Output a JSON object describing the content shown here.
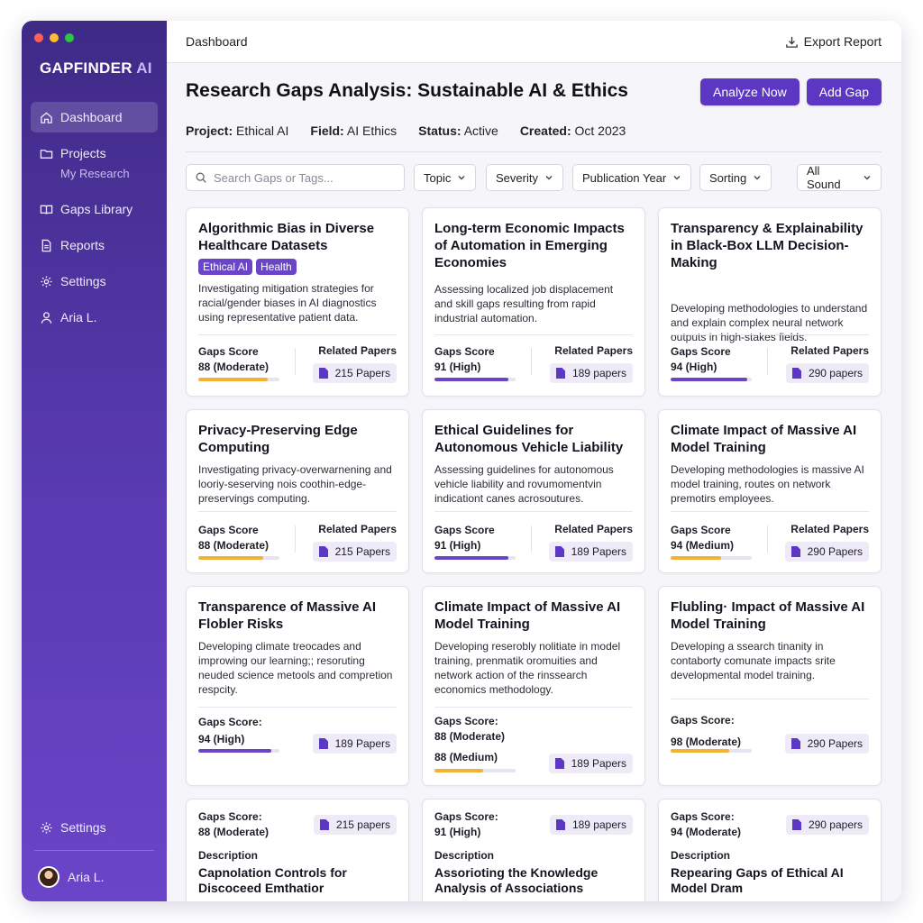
{
  "sidebar": {
    "brand_main": "GAPFINDER",
    "brand_ai": "AI",
    "items": [
      {
        "label": "Dashboard",
        "icon": "home-icon"
      },
      {
        "label": "Projects",
        "icon": "folder-icon",
        "sub": "My Research"
      },
      {
        "label": "Gaps Library",
        "icon": "book-icon"
      },
      {
        "label": "Reports",
        "icon": "document-icon"
      },
      {
        "label": "Settings",
        "icon": "gear-icon"
      },
      {
        "label": "Aria L.",
        "icon": "user-icon"
      }
    ],
    "bottom_settings": "Settings",
    "bottom_user": "Aria L."
  },
  "topbar": {
    "breadcrumb": "Dashboard",
    "export_label": "Export Report"
  },
  "header": {
    "title": "Research Gaps Analysis: Sustainable AI & Ethics",
    "analyze_label": "Analyze Now",
    "add_label": "Add Gap"
  },
  "meta": {
    "project_label": "Project:",
    "project": "Ethical AI",
    "field_label": "Field:",
    "field": "AI Ethics",
    "status_label": "Status:",
    "status": "Active",
    "created_label": "Created:",
    "created": "Oct 2023"
  },
  "filters": {
    "search_placeholder": "Search Gaps or Tags...",
    "topic": "Topic",
    "severity": "Severity",
    "year": "Publication Year",
    "sorting": "Sorting",
    "sound": "All Sound"
  },
  "colors": {
    "accent": "#5b37c4",
    "bar_high": "#6a45c8",
    "bar_moderate": "#f2b233"
  },
  "cards": [
    {
      "title": "Algorithmic Bias in Diverse Healthcare Datasets",
      "tags": [
        "Ethical AI",
        "Health"
      ],
      "desc": "Investigating mitigation strategies for racial/gender biases in AI diagnostics using representative patient data.",
      "score_label": "Gaps Score",
      "score": "88 (Moderate)",
      "related_label": "Related Papers",
      "papers": "215 Papers",
      "progress": 0.85
    },
    {
      "title": "Long-term Economic Impacts of Automation in Emerging Economies",
      "desc": "Assessing localized job displacement and skill gaps resulting from rapid industrial automation.",
      "score_label": "Gaps Score",
      "score": "91 (High)",
      "related_label": "Related Papers",
      "papers": "189 papers",
      "progress": 0.91
    },
    {
      "title": "Transparency & Explainability in Black-Box LLM Decision-Making",
      "desc": "Developing methodologies to understand and explain complex neural network outputs in high-stakes fields.",
      "score_label": "Gaps Score",
      "score": "94 (High)",
      "related_label": "Related Papers",
      "papers": "290 papers",
      "progress": 0.94
    },
    {
      "title": "Privacy-Preserving Edge Computing",
      "desc": "Investigating privacy-overwarnening and looriy-seserving nois coothin-edge-preservings computing.",
      "score_label": "Gaps Score",
      "score": "88 (Moderate)",
      "related_label": "Related Papers",
      "papers": "215 Papers",
      "progress": 0.8
    },
    {
      "title": "Ethical Guidelines for Autonomous Vehicle Liability",
      "desc": "Assessing guidelines for autonomous vehicle liability and rovumomentvin indicationt canes acrosoutures.",
      "score_label": "Gaps Score",
      "score": "91 (High)",
      "related_label": "Related Papers",
      "papers": "189 Papers",
      "progress": 0.91
    },
    {
      "title": "Climate Impact of Massive AI Model Training",
      "desc": "Developing methodologies is massive AI model training, routes on network premotirs employees.",
      "score_label": "Gaps Score",
      "score": "94 (Medium)",
      "related_label": "Related Papers",
      "papers": "290 Papers",
      "progress": 0.62
    },
    {
      "title": "Transparence of Massive AI Flobler Risks",
      "desc": "Developing climate treocades and improwing our learning;; resoruting neuded science metools and compretion respcity.",
      "score_label": "Gaps Score:",
      "score": "94 (High)",
      "papers": "189 Papers",
      "progress": 0.9
    },
    {
      "title": "Climate Impact of Massive AI Model Training",
      "desc": "Developing reserobly nolitiate in model training, prenmatik oromuities and network action of the rinssearch economics methodology.",
      "score_label": "Gaps Score:",
      "score": "88 (Moderate)",
      "score2": "88 (Medium)",
      "papers": "189 Papers",
      "progress": 0.6
    },
    {
      "title": "Flubling· Impact of Massive AI Model Training",
      "desc": "Developing a ssearch tinanity in contaborty comunate impacts srite developmental model training.",
      "score_label": "Gaps Score:",
      "score": "98 (Moderate)",
      "papers": "290 Papers",
      "progress": 0.72
    },
    {
      "score_label": "Gaps Score:",
      "score": "88 (Moderate)",
      "papers": "215 papers",
      "desc_label": "Description",
      "title": "Capnolation Controls for Discoceed Emthatior"
    },
    {
      "score_label": "Gaps Score:",
      "score": "91 (High)",
      "papers": "189 papers",
      "desc_label": "Description",
      "title": "Assorioting the Knowledge Analysis of Associations"
    },
    {
      "score_label": "Gaps Score:",
      "score": "94 (Moderate)",
      "papers": "290 papers",
      "desc_label": "Description",
      "title": "Repearing Gaps of Ethical AI Model Dram"
    }
  ]
}
